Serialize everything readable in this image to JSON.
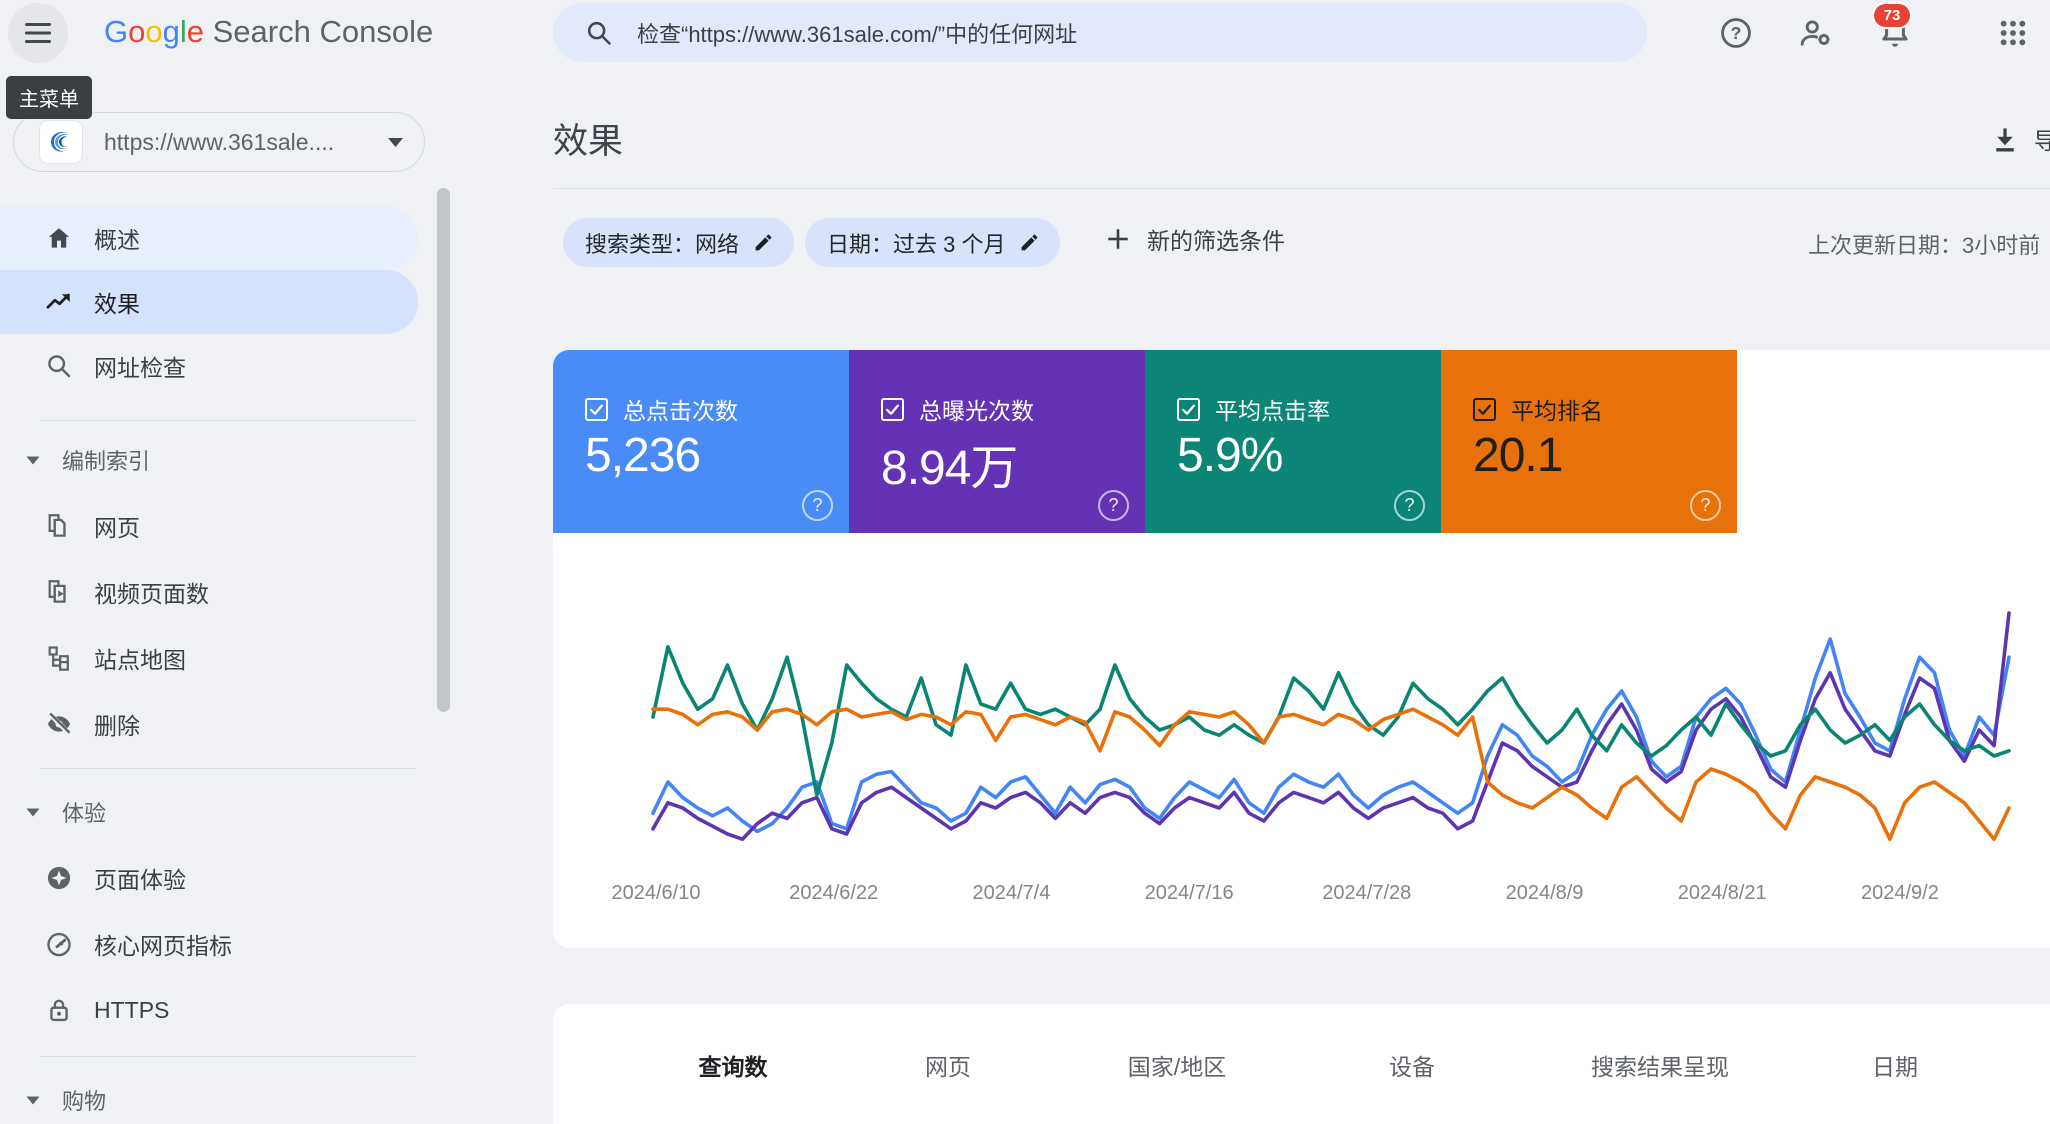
{
  "theme": {
    "app_bg": "#eff1f5",
    "accent_blue": "#4285f4",
    "chip_bg": "#d8e2f8",
    "search_bg": "#e2e9fa",
    "selected_item_bg": "#d4e2fb",
    "hover_item_bg": "#e7eefc",
    "tooltip_bg": "#3b3f42"
  },
  "topbar": {
    "tooltip": "主菜单",
    "logo_letters": [
      {
        "ch": "G",
        "color": "#4285f4"
      },
      {
        "ch": "o",
        "color": "#ea4335"
      },
      {
        "ch": "o",
        "color": "#fbbc05"
      },
      {
        "ch": "g",
        "color": "#4285f4"
      },
      {
        "ch": "l",
        "color": "#34a853"
      },
      {
        "ch": "e",
        "color": "#ea4335"
      }
    ],
    "logo_rest": " Search Console",
    "search_placeholder": "检查“https://www.361sale.com/”中的任何网址",
    "notification_count": "73"
  },
  "sidebar": {
    "property": {
      "label": "https://www.361sale...."
    },
    "top_items": [
      {
        "label": "概述",
        "icon": "home",
        "selected": false
      },
      {
        "label": "效果",
        "icon": "trending-up",
        "selected": true
      },
      {
        "label": "网址检查",
        "icon": "search",
        "selected": false
      }
    ],
    "sections": [
      {
        "header": "编制索引",
        "items": [
          {
            "label": "网页",
            "icon": "pages"
          },
          {
            "label": "视频页面数",
            "icon": "video-pages"
          },
          {
            "label": "站点地图",
            "icon": "sitemap"
          },
          {
            "label": "删除",
            "icon": "visibility-off"
          }
        ]
      },
      {
        "header": "体验",
        "items": [
          {
            "label": "页面体验",
            "icon": "page-experience"
          },
          {
            "label": "核心网页指标",
            "icon": "core-web-vitals"
          },
          {
            "label": "HTTPS",
            "icon": "lock"
          }
        ]
      },
      {
        "header": "购物",
        "items": []
      }
    ]
  },
  "main": {
    "title": "效果",
    "export_label": "导出",
    "filters": [
      {
        "label": "搜索类型：网络"
      },
      {
        "label": "日期：过去 3 个月"
      }
    ],
    "new_filter_label": "新的筛选条件",
    "last_updated": "上次更新日期：3小时前",
    "cards": [
      {
        "label": "总点击次数",
        "value": "5,236",
        "bg": "#4a8cf7",
        "fg": "#ffffff",
        "checked": true
      },
      {
        "label": "总曝光次数",
        "value": "8.94万",
        "bg": "#6433b5",
        "fg": "#ffffff",
        "checked": true
      },
      {
        "label": "平均点击率",
        "value": "5.9%",
        "bg": "#0a8576",
        "fg": "#ffffff",
        "checked": true
      },
      {
        "label": "平均排名",
        "value": "20.1",
        "bg": "#e8710a",
        "fg": "#1f1f1f",
        "checked": true
      }
    ],
    "tabs": [
      {
        "label": "查询数",
        "selected": true
      },
      {
        "label": "网页",
        "selected": false
      },
      {
        "label": "国家/地区",
        "selected": false
      },
      {
        "label": "设备",
        "selected": false
      },
      {
        "label": "搜索结果呈现",
        "selected": false
      },
      {
        "label": "日期",
        "selected": false
      }
    ]
  },
  "chart_data": {
    "type": "line",
    "x_start_date": "2024/6/10",
    "x_end_date": "2024/9/9",
    "x_labels": [
      "2024/6/10",
      "2024/6/22",
      "2024/7/4",
      "2024/7/16",
      "2024/7/28",
      "2024/8/9",
      "2024/8/21",
      "2024/9/2"
    ],
    "y_axis_visible": false,
    "y_unit": "relative-height-percent (0=chart bottom, 100=chart top; no y axis shown in UI)",
    "legend_position": "none (legend lives in the colored metric cards above)",
    "grid": false,
    "series": [
      {
        "name": "总点击次数",
        "color": "#4285f4",
        "values": [
          18,
          30,
          24,
          20,
          17,
          20,
          15,
          11,
          14,
          20,
          28,
          30,
          14,
          12,
          30,
          33,
          34,
          28,
          22,
          20,
          15,
          18,
          28,
          24,
          30,
          32,
          25,
          18,
          28,
          22,
          29,
          31,
          28,
          20,
          16,
          24,
          30,
          27,
          24,
          31,
          22,
          18,
          28,
          33,
          30,
          28,
          33,
          25,
          20,
          25,
          28,
          30,
          26,
          22,
          18,
          22,
          40,
          52,
          48,
          40,
          36,
          30,
          34,
          48,
          58,
          65,
          55,
          38,
          32,
          36,
          55,
          62,
          66,
          60,
          48,
          35,
          30,
          50,
          70,
          85,
          64,
          55,
          45,
          42,
          62,
          78,
          72,
          50,
          40,
          55,
          48,
          78
        ]
      },
      {
        "name": "总曝光次数",
        "color": "#5e35b1",
        "values": [
          12,
          22,
          20,
          16,
          13,
          10,
          8,
          14,
          18,
          16,
          22,
          24,
          12,
          10,
          22,
          26,
          28,
          24,
          20,
          16,
          12,
          15,
          22,
          20,
          24,
          26,
          22,
          16,
          22,
          18,
          24,
          26,
          24,
          18,
          14,
          20,
          24,
          22,
          20,
          26,
          18,
          15,
          22,
          26,
          24,
          22,
          26,
          20,
          16,
          20,
          22,
          24,
          20,
          18,
          12,
          15,
          30,
          45,
          42,
          36,
          32,
          28,
          30,
          42,
          52,
          60,
          50,
          35,
          30,
          34,
          50,
          58,
          62,
          55,
          44,
          32,
          28,
          46,
          62,
          72,
          58,
          50,
          42,
          40,
          56,
          70,
          66,
          46,
          38,
          50,
          44,
          95
        ]
      },
      {
        "name": "平均点击率",
        "color": "#0b8573",
        "values": [
          55,
          82,
          68,
          58,
          62,
          75,
          60,
          50,
          62,
          78,
          55,
          25,
          45,
          75,
          68,
          62,
          58,
          55,
          70,
          52,
          48,
          75,
          60,
          58,
          68,
          58,
          56,
          58,
          55,
          52,
          58,
          75,
          62,
          55,
          50,
          52,
          55,
          50,
          48,
          52,
          48,
          45,
          55,
          70,
          65,
          58,
          72,
          60,
          52,
          48,
          55,
          68,
          62,
          58,
          52,
          58,
          65,
          70,
          60,
          52,
          45,
          50,
          58,
          48,
          42,
          52,
          45,
          40,
          44,
          50,
          55,
          48,
          60,
          52,
          45,
          40,
          42,
          52,
          58,
          50,
          45,
          48,
          52,
          46,
          55,
          60,
          52,
          46,
          42,
          44,
          40,
          42
        ]
      },
      {
        "name": "平均排名",
        "color": "#e8710a",
        "values": [
          58,
          58,
          56,
          52,
          56,
          57,
          55,
          50,
          57,
          58,
          56,
          52,
          57,
          58,
          55,
          56,
          57,
          54,
          56,
          55,
          52,
          57,
          56,
          46,
          55,
          56,
          54,
          52,
          55,
          53,
          42,
          57,
          55,
          50,
          44,
          52,
          57,
          56,
          55,
          57,
          52,
          45,
          55,
          56,
          54,
          52,
          56,
          54,
          50,
          54,
          56,
          58,
          55,
          52,
          48,
          55,
          30,
          25,
          22,
          20,
          24,
          28,
          25,
          20,
          16,
          28,
          32,
          26,
          20,
          15,
          30,
          35,
          33,
          30,
          26,
          18,
          12,
          25,
          32,
          30,
          28,
          25,
          20,
          8,
          22,
          28,
          30,
          26,
          22,
          15,
          8,
          20
        ]
      }
    ]
  }
}
